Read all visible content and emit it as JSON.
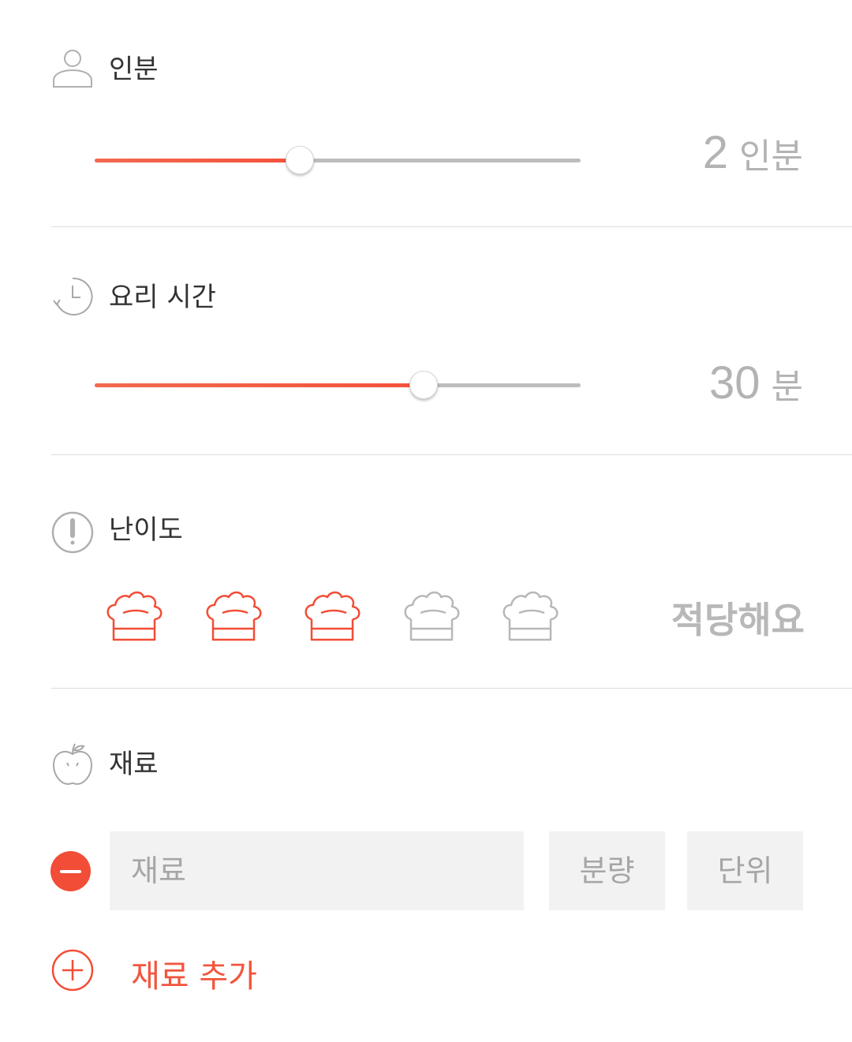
{
  "colors": {
    "accent": "#f24d36",
    "muted": "#b3b3b3",
    "divider": "#dcdcdc",
    "field_bg": "#f2f2f2"
  },
  "servings": {
    "icon": "person-icon",
    "title": "인분",
    "value": "2",
    "unit": "인분",
    "slider_fraction": 0.42
  },
  "cook_time": {
    "icon": "clock-icon",
    "title": "요리 시간",
    "value": "30",
    "unit": "분",
    "slider_fraction": 0.675
  },
  "difficulty": {
    "icon": "alert-icon",
    "title": "난이도",
    "level": 3,
    "max": 5,
    "hat_icon": "chef-hat-icon",
    "label": "적당해요"
  },
  "ingredients": {
    "icon": "apple-icon",
    "title": "재료",
    "row": {
      "remove_icon": "minus-circle-icon",
      "name_placeholder": "재료",
      "amount_placeholder": "분량",
      "unit_placeholder": "단위"
    },
    "add_icon": "plus-circle-icon",
    "add_label": "재료 추가"
  }
}
